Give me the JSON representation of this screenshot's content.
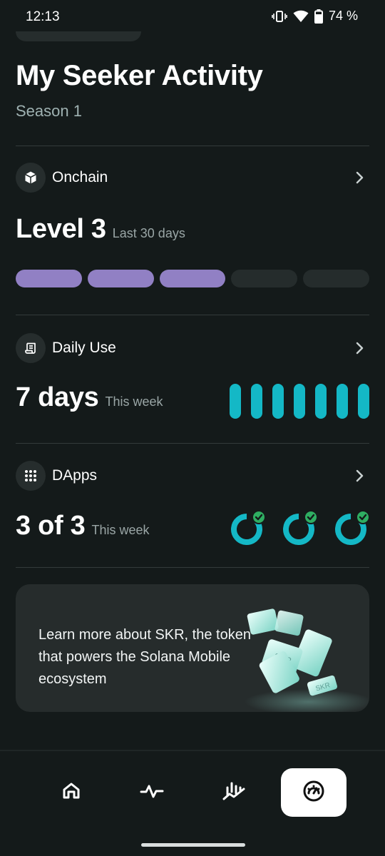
{
  "status": {
    "time": "12:13",
    "battery": "74 %"
  },
  "header": {
    "title": "My Seeker Activity",
    "subtitle": "Season 1"
  },
  "onchain": {
    "label": "Onchain",
    "value": "Level 3",
    "period": "Last 30 days",
    "level": 3,
    "max_level": 5,
    "accent": "#9180c4"
  },
  "daily_use": {
    "label": "Daily Use",
    "value": "7 days",
    "period": "This week",
    "days_active": 7,
    "accent": "#14b8c6"
  },
  "dapps": {
    "label": "DApps",
    "value": "3 of 3",
    "period": "This week",
    "completed": 3,
    "total": 3
  },
  "promo": {
    "text": "Learn more about SKR, the token that powers the Solana Mobile ecosystem",
    "art_label": "SKR"
  },
  "nav": {
    "items": [
      {
        "icon": "home-icon"
      },
      {
        "icon": "activity-icon"
      },
      {
        "icon": "chart-icon"
      },
      {
        "icon": "gauge-icon",
        "active": true
      }
    ]
  }
}
